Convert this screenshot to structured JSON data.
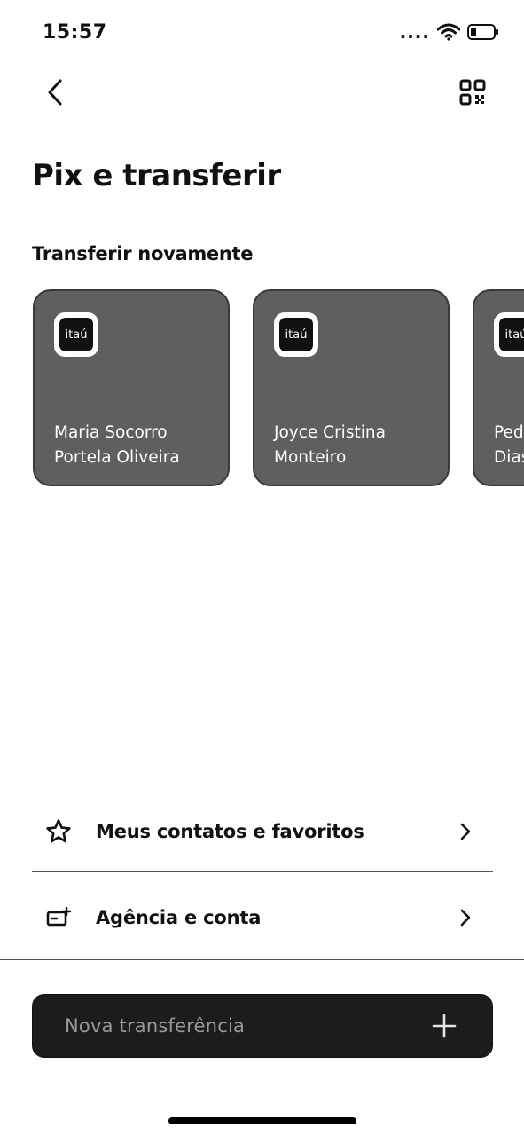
{
  "status_bar": {
    "time": "15:57",
    "signal": "....",
    "icons": [
      "wifi-icon",
      "battery-icon"
    ]
  },
  "header": {
    "back_icon": "chevron-left-icon",
    "qr_icon": "qr-code-icon"
  },
  "page": {
    "title": "Pix e transferir",
    "section_title": "Transferir novamente"
  },
  "recent_transfers": [
    {
      "bank": "itaú",
      "name": "Maria Socorro\nPortela Oliveira"
    },
    {
      "bank": "itaú",
      "name": "Joyce Cristina\nMonteiro"
    },
    {
      "bank": "itaú",
      "name": "Ped\nDias"
    }
  ],
  "menu": {
    "items": [
      {
        "label": "Meus contatos e favoritos",
        "icon": "star-icon"
      },
      {
        "label": "Agência e conta",
        "icon": "bank-card-icon"
      }
    ]
  },
  "actions": {
    "new_transfer_label": "Nova transferência",
    "new_transfer_icon": "plus-icon"
  },
  "colors": {
    "card_background": "#5f5f5f",
    "button_background": "#1c1c1c",
    "text": "#111111"
  }
}
